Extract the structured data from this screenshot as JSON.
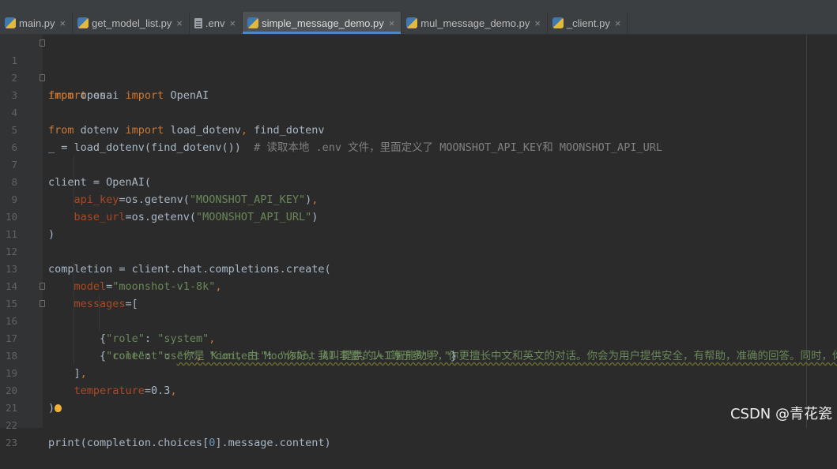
{
  "tabs": [
    {
      "label": "main.py",
      "icon": "python-file-icon"
    },
    {
      "label": "get_model_list.py",
      "icon": "python-file-icon"
    },
    {
      "label": ".env",
      "icon": "text-file-icon"
    },
    {
      "label": "simple_message_demo.py",
      "icon": "python-file-icon",
      "active": true
    },
    {
      "label": "mul_message_demo.py",
      "icon": "python-file-icon"
    },
    {
      "label": "_client.py",
      "icon": "python-file-icon"
    }
  ],
  "close_glyph": "×",
  "line_numbers": [
    "1",
    "2",
    "3",
    "4",
    "5",
    "6",
    "7",
    "8",
    "9",
    "10",
    "11",
    "12",
    "13",
    "14",
    "15",
    "16",
    "17",
    "18",
    "19",
    "20",
    "21",
    "22",
    "23"
  ],
  "code": {
    "l1": {
      "kw": "import",
      "rest": " os"
    },
    "l2": {
      "kw1": "from",
      "mid": " openai ",
      "kw2": "import",
      "rest": " OpenAI"
    },
    "l3": {
      "kw1": "from",
      "mid": " dotenv ",
      "kw2": "import",
      "rest": " load_dotenv",
      "comma": ",",
      "rest2": " find_dotenv"
    },
    "l5": {
      "code": "_ = load_dotenv(find_dotenv())  ",
      "comment": "# 读取本地 .env 文件，里面定义了 MOONSHOT_API_KEY和 MOONSHOT_API_URL"
    },
    "l7": {
      "code": "client = OpenAI("
    },
    "l8": {
      "indent": "    ",
      "param": "api_key",
      "eq": "=os.getenv(",
      "str": "\"MOONSHOT_API_KEY\"",
      "end": ")",
      "comma": ","
    },
    "l9": {
      "indent": "    ",
      "param": "base_url",
      "eq": "=os.getenv(",
      "str": "\"MOONSHOT_API_URL\"",
      "end": ")"
    },
    "l10": {
      "code": ")"
    },
    "l12": {
      "code": "completion = client.chat.completions.create("
    },
    "l13": {
      "indent": "    ",
      "param": "model",
      "eq": "=",
      "str": "\"moonshot-v1-8k\"",
      "comma": ","
    },
    "l14": {
      "indent": "    ",
      "param": "messages",
      "eq": "=["
    },
    "l15": {
      "indent": "        {",
      "str1": "\"role\"",
      "colon": ": ",
      "str2": "\"system\"",
      "comma": ","
    },
    "l16": {
      "indent": "         ",
      "str1": "\"content\"",
      "colon": ": ",
      "str2": "\"你是 Kimi，由 Moonshot AI 提供的人工智能助手，你更擅长中文和英文的对话。你会为用户提供安全，有帮助，准确的回答。同时，你会拒"
    },
    "l17": {
      "indent": "        {",
      "str1": "\"role\"",
      "colon": ": ",
      "str2": "\"user\"",
      "comma1": ", ",
      "str3": "\"content\"",
      "colon2": ": ",
      "str4": "\"你好，我叫李雷，1+1等于多少？\"",
      "end": "}"
    },
    "l18": {
      "indent": "    ]",
      "comma": ","
    },
    "l19": {
      "indent": "    ",
      "param": "temperature",
      "eq": "=0.3",
      "comma": ","
    },
    "l20": {
      "code": ")"
    },
    "l22": {
      "code": "print(completion.choices[",
      "num": "0",
      "end": "].message.content)"
    }
  },
  "watermark": "CSDN @青花瓷"
}
